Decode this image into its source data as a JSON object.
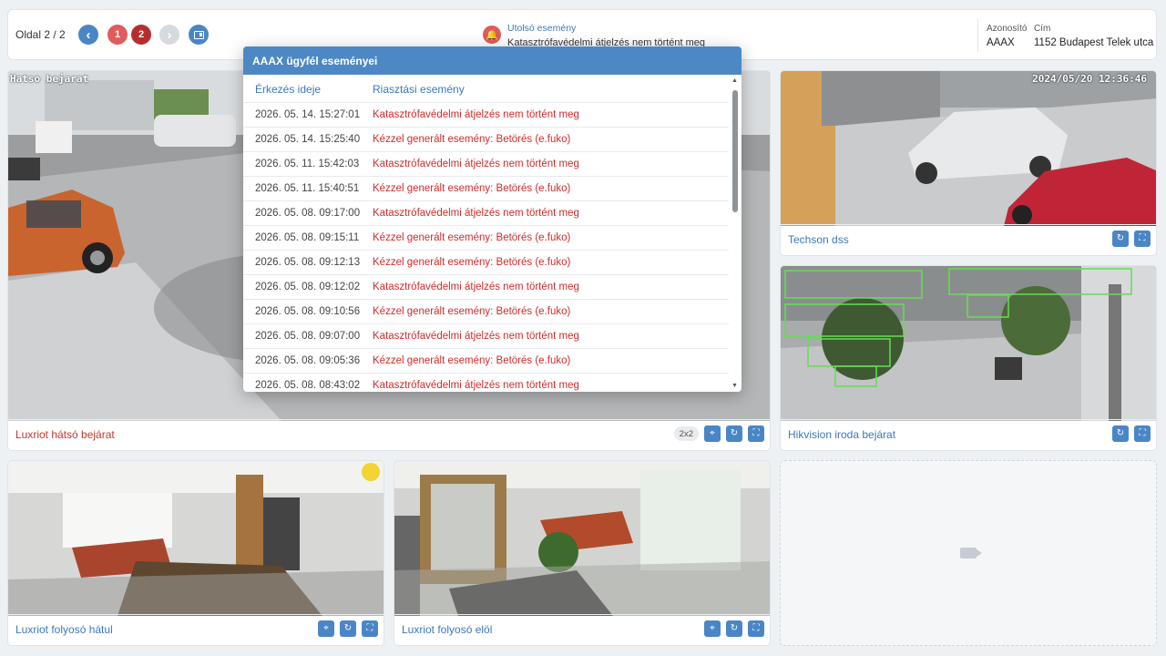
{
  "topbar": {
    "page_label": "Oldal 2 / 2",
    "prev_icon": "chevron-left-icon",
    "pages": [
      "1",
      "2"
    ],
    "next_icon": "chevron-right-icon",
    "monitor_icon": "monitor-icon",
    "last_event": {
      "title": "Utolsó esemény",
      "text": "Katasztrófavédelmi átjelzés nem történt meg"
    },
    "id_header": "Azonosító",
    "id_value": "AAAX",
    "address_header": "Cím",
    "address_value": "1152 Budapest Telek utca"
  },
  "cameras": [
    {
      "name": "Luxriot hátsó bejárat",
      "status": "alert",
      "osd_title": "Hatso bejarat",
      "badge": "2x2"
    },
    {
      "name": "Techson dss",
      "osd_title": "2024/05/20 12:36:46"
    },
    {
      "name": "Hikvision iroda bejárat"
    },
    {
      "name": "Luxriot folyosó hátul"
    },
    {
      "name": "Luxriot folyosó elöl"
    }
  ],
  "modal": {
    "title": "AAAX ügyfél eseményei",
    "col_time": "Érkezés ideje",
    "col_event": "Riasztási esemény",
    "rows": [
      {
        "time": "2026. 05. 14. 15:27:01",
        "event": "Katasztrófavédelmi átjelzés nem történt meg"
      },
      {
        "time": "2026. 05. 14. 15:25:40",
        "event": "Kézzel generált esemény: Betörés (e.fuko)"
      },
      {
        "time": "2026. 05. 11. 15:42:03",
        "event": "Katasztrófavédelmi átjelzés nem történt meg"
      },
      {
        "time": "2026. 05. 11. 15:40:51",
        "event": "Kézzel generált esemény: Betörés (e.fuko)"
      },
      {
        "time": "2026. 05. 08. 09:17:00",
        "event": "Katasztrófavédelmi átjelzés nem történt meg"
      },
      {
        "time": "2026. 05. 08. 09:15:11",
        "event": "Kézzel generált esemény: Betörés (e.fuko)"
      },
      {
        "time": "2026. 05. 08. 09:12:13",
        "event": "Kézzel generált esemény: Betörés (e.fuko)"
      },
      {
        "time": "2026. 05. 08. 09:12:02",
        "event": "Katasztrófavédelmi átjelzés nem történt meg"
      },
      {
        "time": "2026. 05. 08. 09:10:56",
        "event": "Kézzel generált esemény: Betörés (e.fuko)"
      },
      {
        "time": "2026. 05. 08. 09:07:00",
        "event": "Katasztrófavédelmi átjelzés nem történt meg"
      },
      {
        "time": "2026. 05. 08. 09:05:36",
        "event": "Kézzel generált esemény: Betörés (e.fuko)"
      },
      {
        "time": "2026. 05. 08. 08:43:02",
        "event": "Katasztrófavédelmi átjelzés nem történt meg"
      }
    ]
  },
  "colors": {
    "accent": "#4a86c5",
    "alert": "#d12b2b",
    "page_active": "#b72d2d"
  }
}
